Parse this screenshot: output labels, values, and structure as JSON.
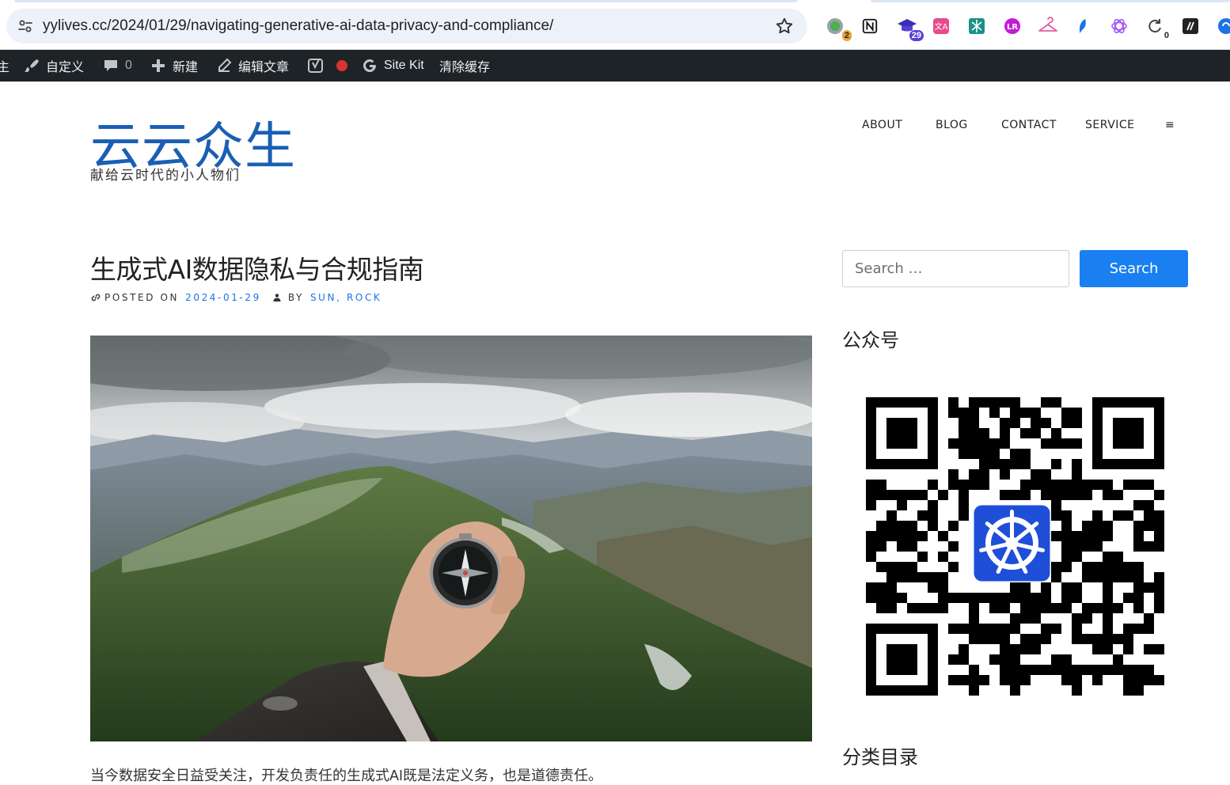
{
  "browser": {
    "url": "yylives.cc/2024/01/29/navigating-generative-ai-data-privacy-and-compliance/",
    "extensions": [
      {
        "icon": "ext-green-circle-icon",
        "badge": "2",
        "badge_color": "#e8a33a"
      },
      {
        "icon": "notion-icon",
        "badge": ""
      },
      {
        "icon": "graduation-cap-icon",
        "badge": "29",
        "badge_color": "#5b3fd6"
      },
      {
        "icon": "translate-icon",
        "badge": ""
      },
      {
        "icon": "ext-teal-icon",
        "badge": ""
      },
      {
        "icon": "ext-purple-circle-icon",
        "badge": ""
      },
      {
        "icon": "hanger-icon",
        "badge": ""
      },
      {
        "icon": "ext-blue-feather-icon",
        "badge": ""
      },
      {
        "icon": "openai-icon",
        "badge": ""
      },
      {
        "icon": "refresh-ext-icon",
        "badge": "0",
        "badge_color": "#333333"
      },
      {
        "icon": "ext-dark-icon",
        "badge": ""
      },
      {
        "icon": "ext-blue-partial-icon",
        "badge": ""
      }
    ]
  },
  "adminbar": {
    "partial_left": "主",
    "customize": "自定义",
    "comments_count": "0",
    "new": "新建",
    "edit_post": "编辑文章",
    "site_kit": "Site Kit",
    "clear_cache": "清除缓存",
    "status_color": "#dc3232"
  },
  "site": {
    "title": "云云众生",
    "description": "献给云时代的小人物们",
    "title_color": "#1a5fb4"
  },
  "nav": {
    "items": [
      "ABOUT",
      "BLOG",
      "CONTACT",
      "SERVICE",
      "≡"
    ]
  },
  "post": {
    "title": "生成式AI数据隐私与合规指南",
    "posted_on_label": "POSTED ON",
    "date": "2024-01-29",
    "by_label": "BY",
    "author": "SUN, ROCK",
    "excerpt": "当今数据安全日益受关注，开发负责任的生成式AI既是法定义务，也是道德责任。",
    "link_color": "#1a73e8"
  },
  "sidebar": {
    "search_placeholder": "Search …",
    "search_button": "Search",
    "widget_wechat_title": "公众号",
    "widget_categories_title": "分类目录",
    "accent": "#1a7ff0"
  }
}
